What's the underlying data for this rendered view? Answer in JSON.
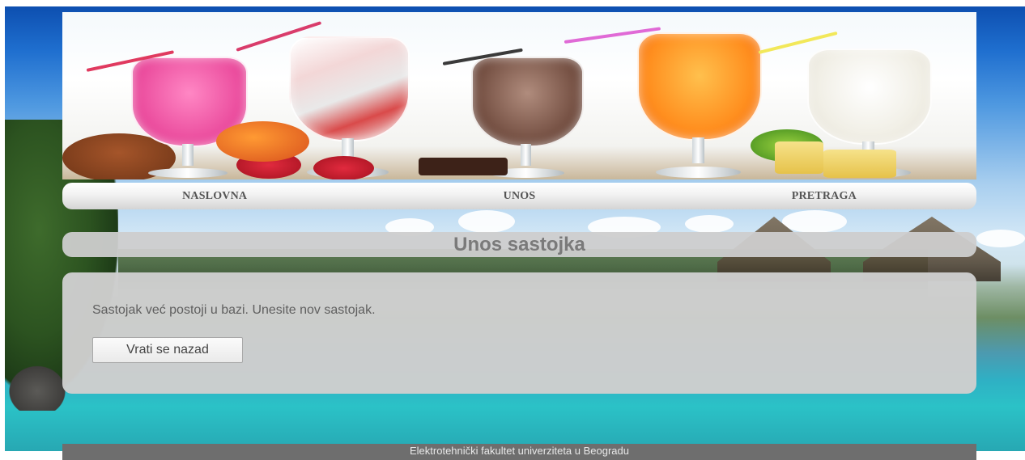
{
  "nav": {
    "items": [
      {
        "label": "NASLOVNA"
      },
      {
        "label": "UNOS"
      },
      {
        "label": "PRETRAGA"
      }
    ]
  },
  "page": {
    "title": "Unos sastojka"
  },
  "content": {
    "message": "Sastojak već postoji u bazi. Unesite nov sastojak.",
    "back_button_label": "Vrati se nazad"
  },
  "footer": {
    "text": "Elektrotehnički fakultet univerziteta u Beogradu"
  },
  "colors": {
    "panel_bg": "#cecece",
    "footer_bg": "#6e6e6e",
    "title_text": "#7a7a7a"
  }
}
